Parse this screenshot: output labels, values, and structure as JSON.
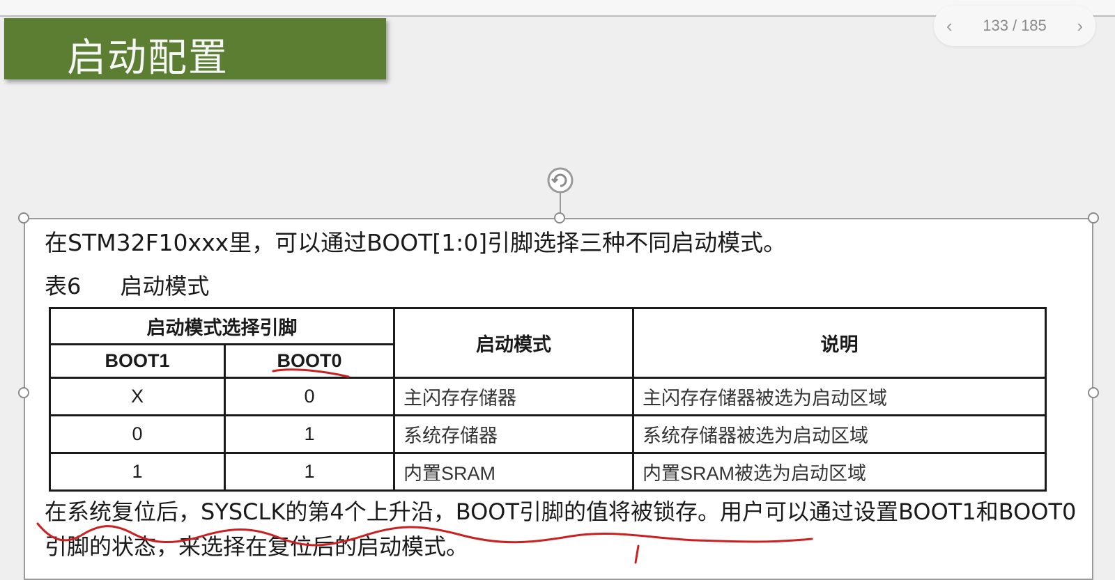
{
  "slide": {
    "title": "启动配置",
    "intro": "在STM32F10xxx里，可以通过BOOT[1:0]引脚选择三种不同启动模式。",
    "caption": {
      "label": "表6",
      "text": "启动模式"
    },
    "table": {
      "group_header": "启动模式选择引脚",
      "headers": {
        "boot1": "BOOT1",
        "boot0": "BOOT0",
        "mode": "启动模式",
        "desc": "说明"
      },
      "rows": [
        {
          "boot1": "X",
          "boot0": "0",
          "mode": "主闪存存储器",
          "desc": "主闪存存储器被选为启动区域"
        },
        {
          "boot1": "0",
          "boot0": "1",
          "mode": "系统存储器",
          "desc": "系统存储器被选为启动区域"
        },
        {
          "boot1": "1",
          "boot0": "1",
          "mode": "内置SRAM",
          "desc": "内置SRAM被选为启动区域"
        }
      ]
    },
    "paragraph": "在系统复位后，SYSCLK的第4个上升沿，BOOT引脚的值将被锁存。用户可以通过设置BOOT1和BOOT0引脚的状态，来选择在复位后的启动模式。"
  },
  "pager": {
    "current": "133",
    "separator": "/",
    "total": "185"
  },
  "colors": {
    "title_bg": "#5b7e32",
    "annotation_ink": "#cc1f1f"
  },
  "icons": {
    "prev": "chevron-left-icon",
    "next": "chevron-right-icon",
    "rotate": "rotate-handle-icon"
  }
}
